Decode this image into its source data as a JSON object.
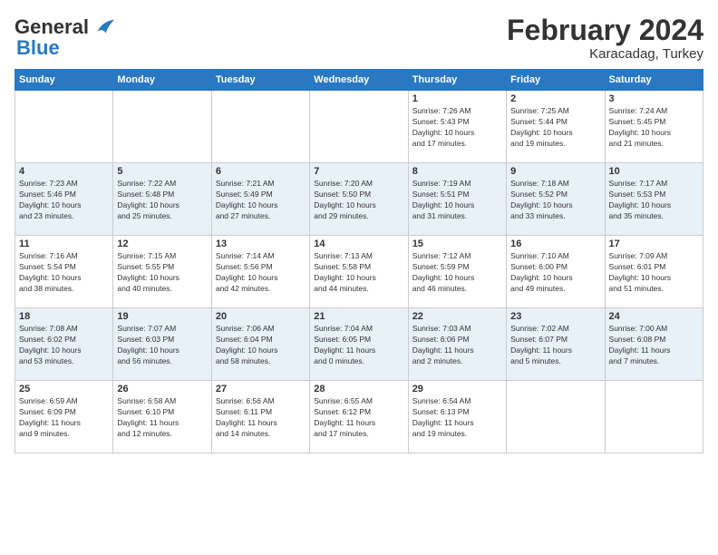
{
  "header": {
    "logo_general": "General",
    "logo_blue": "Blue",
    "month_title": "February 2024",
    "location": "Karacadag, Turkey"
  },
  "days_of_week": [
    "Sunday",
    "Monday",
    "Tuesday",
    "Wednesday",
    "Thursday",
    "Friday",
    "Saturday"
  ],
  "weeks": [
    {
      "days": [
        {
          "num": "",
          "info": ""
        },
        {
          "num": "",
          "info": ""
        },
        {
          "num": "",
          "info": ""
        },
        {
          "num": "",
          "info": ""
        },
        {
          "num": "1",
          "info": "Sunrise: 7:26 AM\nSunset: 5:43 PM\nDaylight: 10 hours\nand 17 minutes."
        },
        {
          "num": "2",
          "info": "Sunrise: 7:25 AM\nSunset: 5:44 PM\nDaylight: 10 hours\nand 19 minutes."
        },
        {
          "num": "3",
          "info": "Sunrise: 7:24 AM\nSunset: 5:45 PM\nDaylight: 10 hours\nand 21 minutes."
        }
      ]
    },
    {
      "days": [
        {
          "num": "4",
          "info": "Sunrise: 7:23 AM\nSunset: 5:46 PM\nDaylight: 10 hours\nand 23 minutes."
        },
        {
          "num": "5",
          "info": "Sunrise: 7:22 AM\nSunset: 5:48 PM\nDaylight: 10 hours\nand 25 minutes."
        },
        {
          "num": "6",
          "info": "Sunrise: 7:21 AM\nSunset: 5:49 PM\nDaylight: 10 hours\nand 27 minutes."
        },
        {
          "num": "7",
          "info": "Sunrise: 7:20 AM\nSunset: 5:50 PM\nDaylight: 10 hours\nand 29 minutes."
        },
        {
          "num": "8",
          "info": "Sunrise: 7:19 AM\nSunset: 5:51 PM\nDaylight: 10 hours\nand 31 minutes."
        },
        {
          "num": "9",
          "info": "Sunrise: 7:18 AM\nSunset: 5:52 PM\nDaylight: 10 hours\nand 33 minutes."
        },
        {
          "num": "10",
          "info": "Sunrise: 7:17 AM\nSunset: 5:53 PM\nDaylight: 10 hours\nand 35 minutes."
        }
      ]
    },
    {
      "days": [
        {
          "num": "11",
          "info": "Sunrise: 7:16 AM\nSunset: 5:54 PM\nDaylight: 10 hours\nand 38 minutes."
        },
        {
          "num": "12",
          "info": "Sunrise: 7:15 AM\nSunset: 5:55 PM\nDaylight: 10 hours\nand 40 minutes."
        },
        {
          "num": "13",
          "info": "Sunrise: 7:14 AM\nSunset: 5:56 PM\nDaylight: 10 hours\nand 42 minutes."
        },
        {
          "num": "14",
          "info": "Sunrise: 7:13 AM\nSunset: 5:58 PM\nDaylight: 10 hours\nand 44 minutes."
        },
        {
          "num": "15",
          "info": "Sunrise: 7:12 AM\nSunset: 5:59 PM\nDaylight: 10 hours\nand 46 minutes."
        },
        {
          "num": "16",
          "info": "Sunrise: 7:10 AM\nSunset: 6:00 PM\nDaylight: 10 hours\nand 49 minutes."
        },
        {
          "num": "17",
          "info": "Sunrise: 7:09 AM\nSunset: 6:01 PM\nDaylight: 10 hours\nand 51 minutes."
        }
      ]
    },
    {
      "days": [
        {
          "num": "18",
          "info": "Sunrise: 7:08 AM\nSunset: 6:02 PM\nDaylight: 10 hours\nand 53 minutes."
        },
        {
          "num": "19",
          "info": "Sunrise: 7:07 AM\nSunset: 6:03 PM\nDaylight: 10 hours\nand 56 minutes."
        },
        {
          "num": "20",
          "info": "Sunrise: 7:06 AM\nSunset: 6:04 PM\nDaylight: 10 hours\nand 58 minutes."
        },
        {
          "num": "21",
          "info": "Sunrise: 7:04 AM\nSunset: 6:05 PM\nDaylight: 11 hours\nand 0 minutes."
        },
        {
          "num": "22",
          "info": "Sunrise: 7:03 AM\nSunset: 6:06 PM\nDaylight: 11 hours\nand 2 minutes."
        },
        {
          "num": "23",
          "info": "Sunrise: 7:02 AM\nSunset: 6:07 PM\nDaylight: 11 hours\nand 5 minutes."
        },
        {
          "num": "24",
          "info": "Sunrise: 7:00 AM\nSunset: 6:08 PM\nDaylight: 11 hours\nand 7 minutes."
        }
      ]
    },
    {
      "days": [
        {
          "num": "25",
          "info": "Sunrise: 6:59 AM\nSunset: 6:09 PM\nDaylight: 11 hours\nand 9 minutes."
        },
        {
          "num": "26",
          "info": "Sunrise: 6:58 AM\nSunset: 6:10 PM\nDaylight: 11 hours\nand 12 minutes."
        },
        {
          "num": "27",
          "info": "Sunrise: 6:56 AM\nSunset: 6:11 PM\nDaylight: 11 hours\nand 14 minutes."
        },
        {
          "num": "28",
          "info": "Sunrise: 6:55 AM\nSunset: 6:12 PM\nDaylight: 11 hours\nand 17 minutes."
        },
        {
          "num": "29",
          "info": "Sunrise: 6:54 AM\nSunset: 6:13 PM\nDaylight: 11 hours\nand 19 minutes."
        },
        {
          "num": "",
          "info": ""
        },
        {
          "num": "",
          "info": ""
        }
      ]
    }
  ]
}
